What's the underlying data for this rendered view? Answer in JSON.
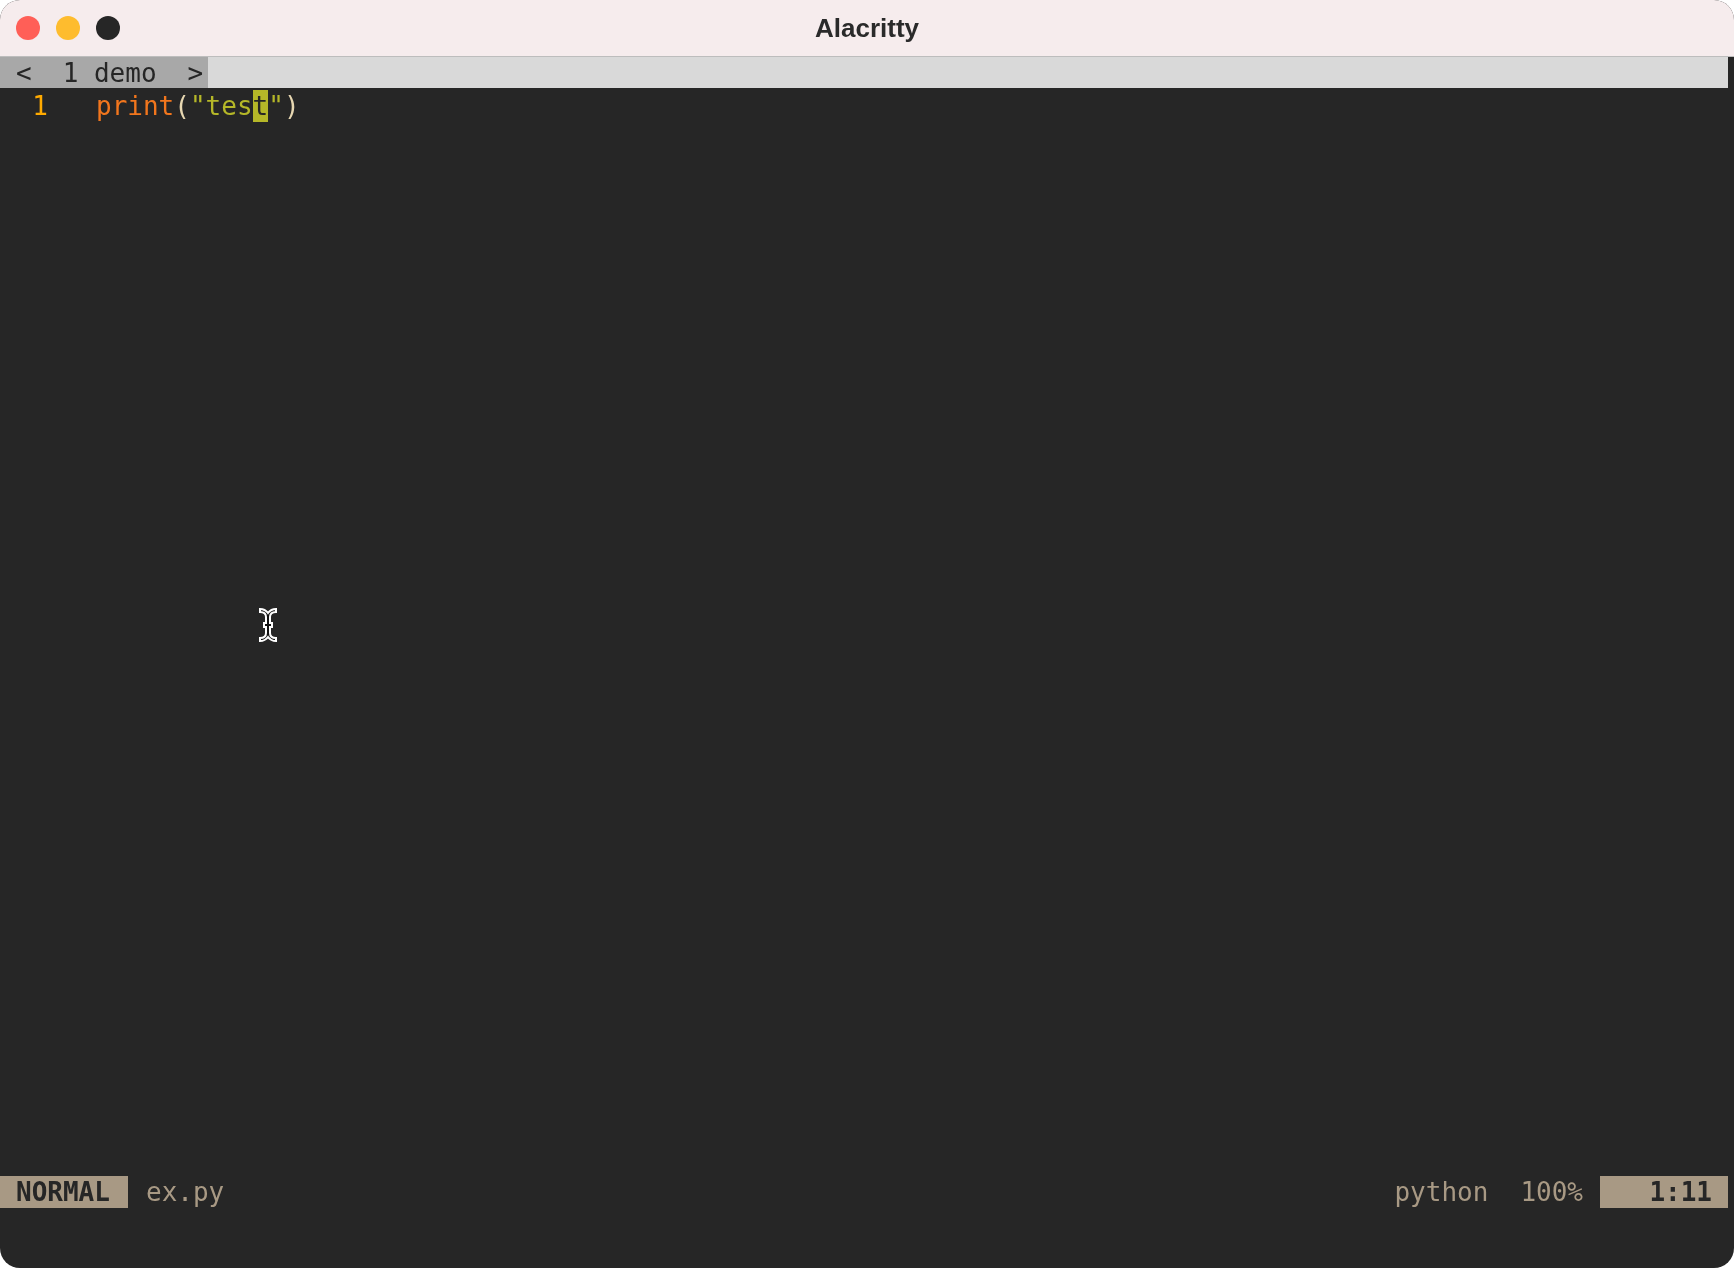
{
  "window": {
    "title": "Alacritty"
  },
  "tabline": {
    "prev": "<",
    "next": ">",
    "tabs": [
      {
        "label": "1 demo",
        "selected": true
      }
    ]
  },
  "editor": {
    "lines": [
      {
        "number": "1",
        "tokens": [
          {
            "text": "print",
            "kind": "function",
            "cursor": false
          },
          {
            "text": "(",
            "kind": "punct",
            "cursor": false
          },
          {
            "text": "\"tes",
            "kind": "string",
            "cursor": false
          },
          {
            "text": "t",
            "kind": "string",
            "cursor": true
          },
          {
            "text": "\"",
            "kind": "string",
            "cursor": false
          },
          {
            "text": ")",
            "kind": "punct",
            "cursor": false
          }
        ]
      }
    ]
  },
  "status_bar": {
    "mode": "NORMAL",
    "file": "ex.py",
    "filetype": "python",
    "percent": "100%",
    "position": "1:11"
  }
}
